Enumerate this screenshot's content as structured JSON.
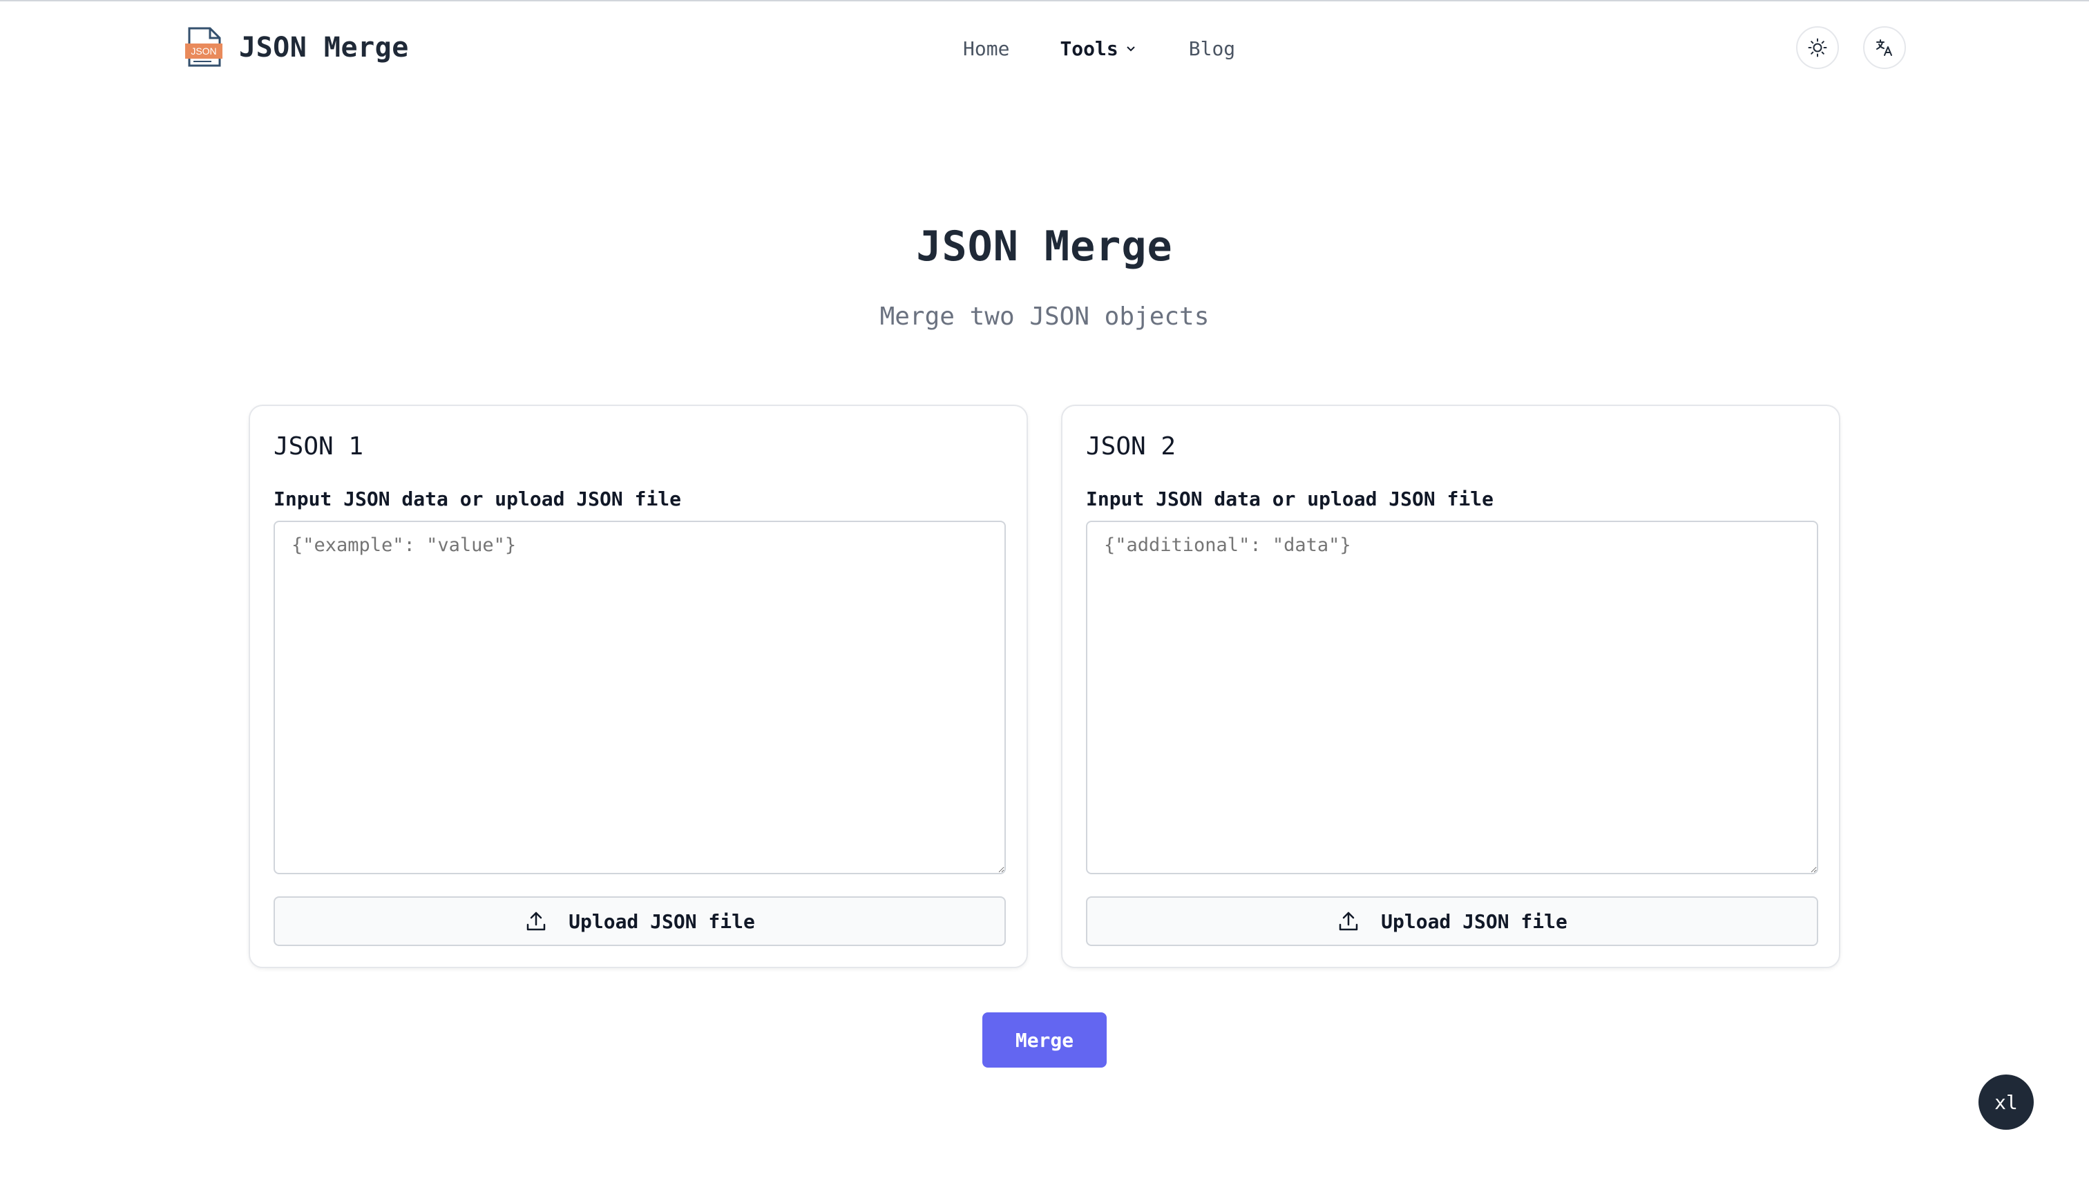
{
  "header": {
    "brand_name": "JSON Merge",
    "logo_text": "JSON",
    "nav": {
      "home": "Home",
      "tools": "Tools",
      "blog": "Blog"
    }
  },
  "hero": {
    "title": "JSON Merge",
    "subtitle": "Merge two JSON objects"
  },
  "cards": [
    {
      "title": "JSON 1",
      "label": "Input JSON data or upload JSON file",
      "placeholder": "{\"example\": \"value\"}",
      "value": "",
      "upload_label": "Upload JSON file"
    },
    {
      "title": "JSON 2",
      "label": "Input JSON data or upload JSON file",
      "placeholder": "{\"additional\": \"data\"}",
      "value": "",
      "upload_label": "Upload JSON file"
    }
  ],
  "merge_label": "Merge",
  "badge_label": "xl",
  "colors": {
    "accent": "#6366f1",
    "logo_orange": "#e98a5b",
    "logo_navy": "#34506e",
    "text_dark": "#1f2937",
    "text_muted": "#6b7280",
    "badge_bg": "#1f2937"
  },
  "icons": {
    "logo": "json-file-icon",
    "tools_dropdown": "chevron-down-icon",
    "theme": "sun-icon",
    "language": "translate-icon",
    "upload": "upload-icon"
  }
}
